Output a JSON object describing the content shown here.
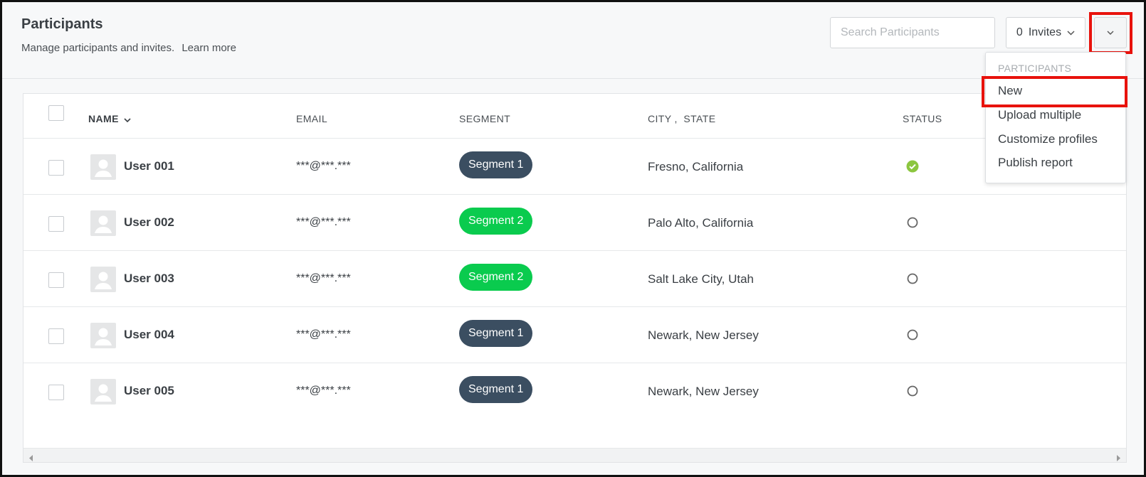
{
  "header": {
    "title": "Participants",
    "subtitle": "Manage participants and invites.",
    "learn_more": "Learn more"
  },
  "search": {
    "placeholder": "Search Participants",
    "value": ""
  },
  "invites": {
    "count": "0",
    "label": "Invites"
  },
  "dropdown": {
    "section": "PARTICIPANTS",
    "items": [
      "New",
      "Upload multiple",
      "Customize profiles",
      "Publish report"
    ]
  },
  "table": {
    "headers": {
      "name": "NAME",
      "email": "EMAIL",
      "segment": "SEGMENT",
      "city": "CITY ,  STATE",
      "status": "STATUS"
    },
    "rows": [
      {
        "name": "User 001",
        "email": "***@***.***",
        "segment": "Segment 1",
        "location": "Fresno, California",
        "status": "active"
      },
      {
        "name": "User 002",
        "email": "***@***.***",
        "segment": "Segment 2",
        "location": "Palo Alto, California",
        "status": "inactive"
      },
      {
        "name": "User 003",
        "email": "***@***.***",
        "segment": "Segment 2",
        "location": "Salt Lake City, Utah",
        "status": "inactive"
      },
      {
        "name": "User 004",
        "email": "***@***.***",
        "segment": "Segment 1",
        "location": "Newark, New Jersey",
        "status": "inactive"
      },
      {
        "name": "User 005",
        "email": "***@***.***",
        "segment": "Segment 1",
        "location": "Newark, New Jersey",
        "status": "inactive"
      }
    ]
  },
  "colors": {
    "segment_1": "#3b4e61",
    "segment_2": "#0acb4e",
    "status_active": "#8cc63f",
    "highlight": "#e8120c"
  }
}
